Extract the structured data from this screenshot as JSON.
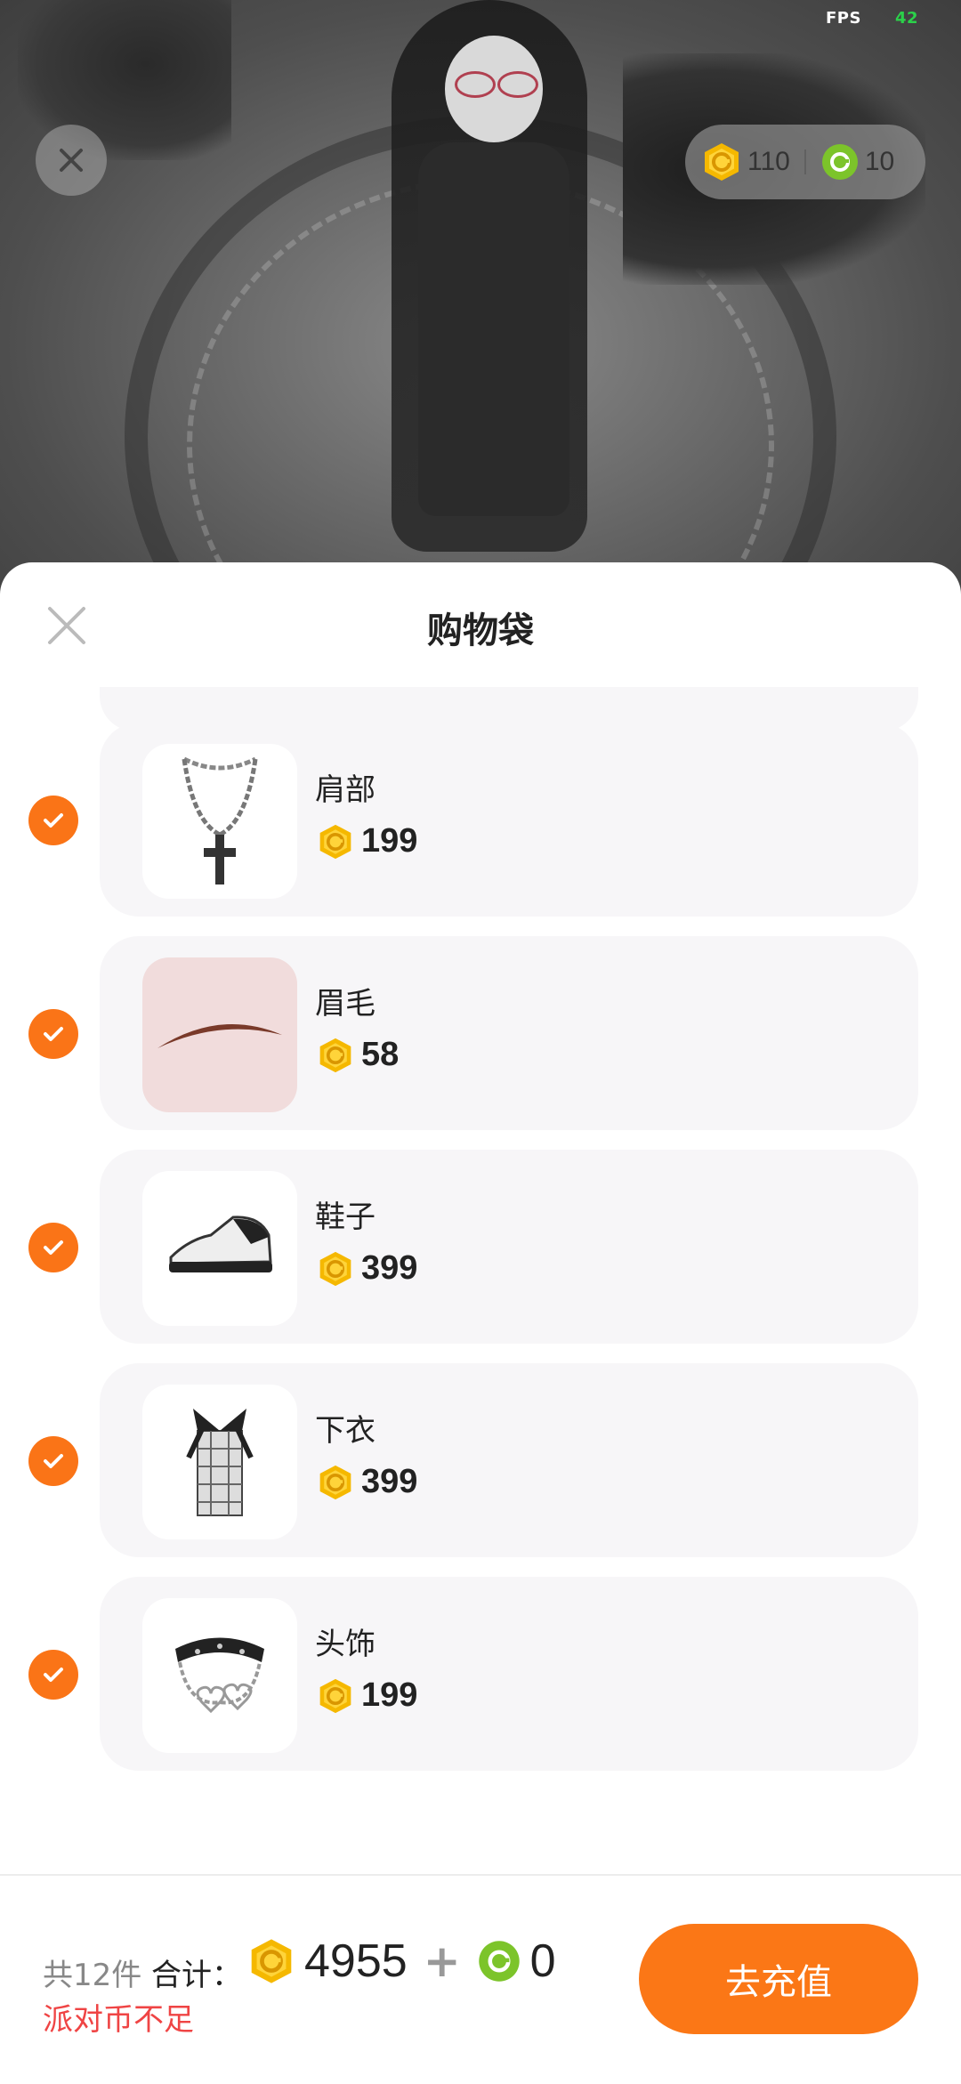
{
  "status": {
    "fps_label": "FPS",
    "fps_value": "42"
  },
  "balance": {
    "gold": "110",
    "green": "10"
  },
  "sheet": {
    "title": "购物袋"
  },
  "items": [
    {
      "name": "肩部",
      "price": "199",
      "checked": true,
      "image": "cross-necklace"
    },
    {
      "name": "眉毛",
      "price": "58",
      "checked": true,
      "image": "eyebrow"
    },
    {
      "name": "鞋子",
      "price": "399",
      "checked": true,
      "image": "sneaker"
    },
    {
      "name": "下衣",
      "price": "399",
      "checked": true,
      "image": "plaid-skirt"
    },
    {
      "name": "头饰",
      "price": "199",
      "checked": true,
      "image": "heart-choker"
    }
  ],
  "footer": {
    "count": "共12件",
    "total_label": "合计：",
    "gold_total": "4955",
    "plus": "+",
    "green_total": "0",
    "warning": "派对币不足",
    "recharge_label": "去充值"
  },
  "colors": {
    "accent": "#fb7716",
    "warning": "#ef4444",
    "gold": "#f5b800",
    "green": "#7cc42a"
  }
}
